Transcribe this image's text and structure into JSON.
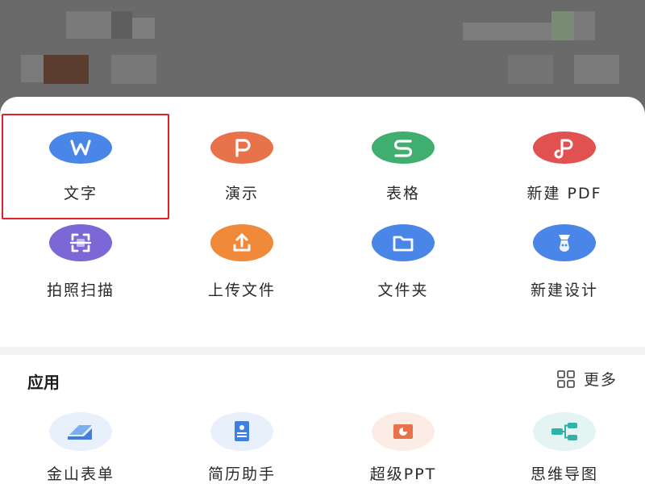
{
  "create_grid": [
    {
      "label": "文字",
      "icon": "writer-w-icon",
      "color": "#4a86e8"
    },
    {
      "label": "演示",
      "icon": "presentation-p-icon",
      "color": "#e8734a"
    },
    {
      "label": "表格",
      "icon": "spreadsheet-s-icon",
      "color": "#3fae6e"
    },
    {
      "label": "新建 PDF",
      "icon": "pdf-icon",
      "color": "#e0514f"
    },
    {
      "label": "拍照扫描",
      "icon": "scan-icon",
      "color": "#7c67d6"
    },
    {
      "label": "上传文件",
      "icon": "upload-icon",
      "color": "#f08a3a"
    },
    {
      "label": "文件夹",
      "icon": "folder-icon",
      "color": "#4a86e8"
    },
    {
      "label": "新建设计",
      "icon": "design-icon",
      "color": "#4a86e8"
    }
  ],
  "apps_section": {
    "title": "应用",
    "more_label": "更多"
  },
  "apps": [
    {
      "label": "金山表单",
      "icon": "form-icon",
      "color": "#e7f0fb"
    },
    {
      "label": "简历助手",
      "icon": "resume-icon",
      "color": "#e7f0fb"
    },
    {
      "label": "超级PPT",
      "icon": "super-ppt-icon",
      "color": "#fcece6"
    },
    {
      "label": "思维导图",
      "icon": "mind-map-icon",
      "color": "#e4f4f3"
    }
  ]
}
